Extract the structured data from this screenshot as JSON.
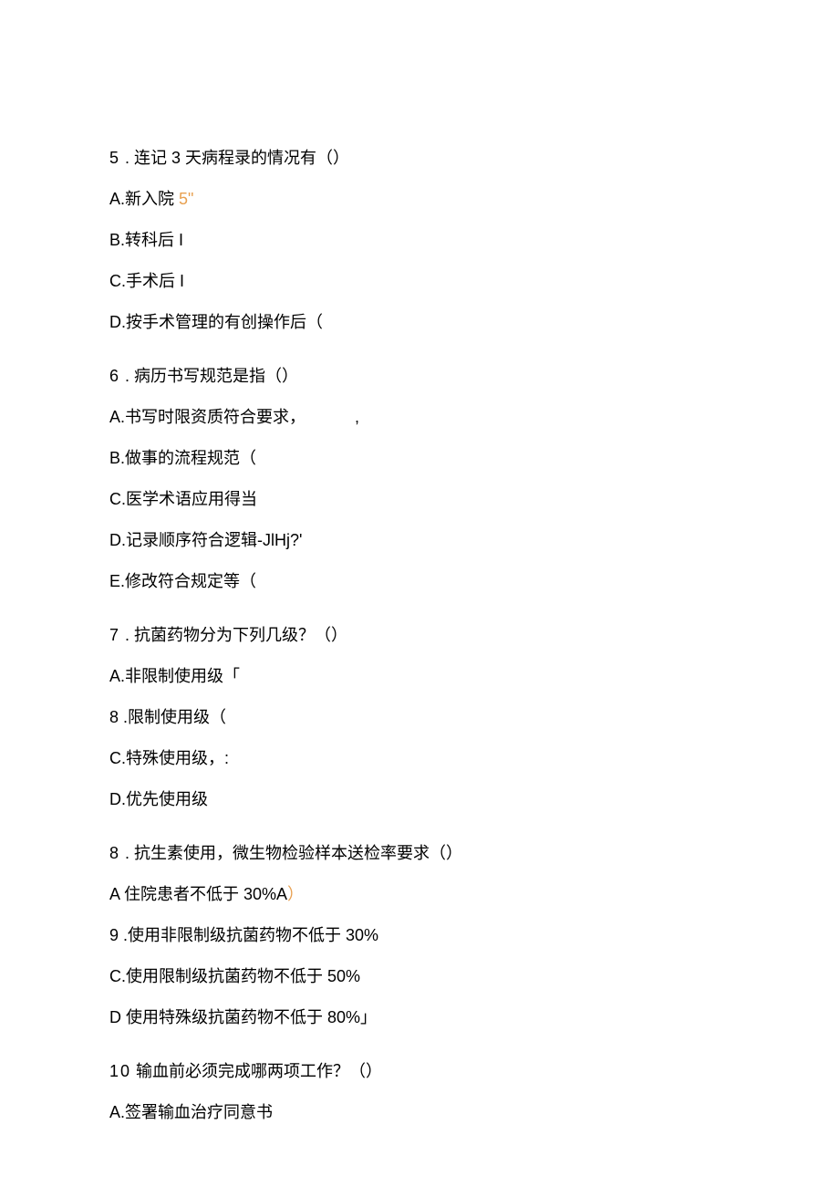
{
  "questions": [
    {
      "num": "5",
      "title": " . 连记 3 天病程录的情况有（）",
      "options": [
        {
          "label": "A.新入院",
          "extra_orange": " 5\""
        },
        {
          "label": "B.转科后 I"
        },
        {
          "label": "C.手术后 I"
        },
        {
          "label": "D.按手术管理的有创操作后（"
        }
      ]
    },
    {
      "num": "6",
      "title": " . 病历书写规范是指（）",
      "options": [
        {
          "label": "A.书写时限资质符合要求，   ,"
        },
        {
          "label": "B.做事的流程规范（"
        },
        {
          "label": "C.医学术语应用得当"
        },
        {
          "label": "D.记录顺序符合逻辑-JlHj?'"
        },
        {
          "label": "E.修改符合规定等（"
        }
      ]
    },
    {
      "num": "7",
      "title": " . 抗菌药物分为下列几级？（）",
      "options": [
        {
          "label": "A.非限制使用级「"
        },
        {
          "label": "8   .限制使用级（"
        },
        {
          "label": "C.特殊使用级，:"
        },
        {
          "label": "D.优先使用级"
        }
      ]
    },
    {
      "num": "8",
      "title": " . 抗生素使用，微生物检验样本送检率要求（）",
      "options": [
        {
          "label": "A 住院患者不低于 30%A",
          "trailing_orange": "）"
        },
        {
          "label": "9   .使用非限制级抗菌药物不低于 30%"
        },
        {
          "label": "C.使用限制级抗菌药物不低于 50%"
        },
        {
          "label": "D 使用特殊级抗菌药物不低于 80%」"
        }
      ]
    },
    {
      "num": "10",
      "title": "  输血前必须完成哪两项工作？（）",
      "options": [
        {
          "label": "A.签署输血治疗同意书"
        }
      ]
    }
  ]
}
